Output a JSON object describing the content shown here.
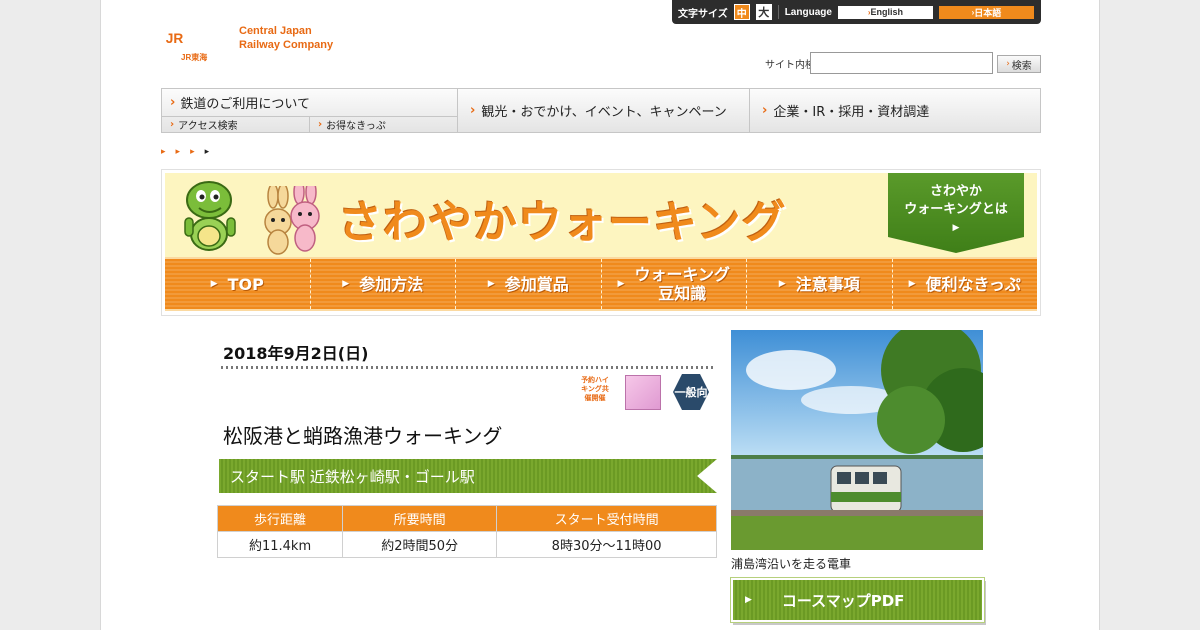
{
  "header": {
    "logo_mark": "JR",
    "logo_line1": "Central Japan",
    "logo_line2": "Railway Company",
    "logo_sub": "JR東海"
  },
  "toolbar": {
    "font_size_label": "文字サイズ",
    "font_mid": "中",
    "font_big": "大",
    "language_label": "Language",
    "lang_en": "English",
    "lang_jp": "日本語"
  },
  "search": {
    "label": "サイト内検索",
    "placeholder": "",
    "button": "検索"
  },
  "nav": {
    "main": "鉄道のご利用について",
    "sub1": "アクセス検索",
    "sub2": "お得なきっぷ",
    "tourism": "観光・おでかけ、イベント、キャンペーン",
    "corporate": "企業・IR・採用・資材調達"
  },
  "banner": {
    "title": "さわやかウォーキング",
    "about_line1": "さわやか",
    "about_line2": "ウォーキングとは",
    "about_arrow": "▶"
  },
  "gnav": [
    {
      "label": "TOP"
    },
    {
      "label": "参加方法"
    },
    {
      "label": "参加賞品"
    },
    {
      "label": "ウォーキング\n豆知識"
    },
    {
      "label": "注意事項"
    },
    {
      "label": "便利なきっぷ"
    }
  ],
  "event": {
    "date": "2018年9月2日(日)",
    "badge1": "予約ハイキング共催開催",
    "badge3": "一般向",
    "title": "松阪港と蛸路漁港ウォーキング",
    "course": "スタート駅 近鉄松ヶ崎駅・ゴール駅",
    "table_headers": [
      "歩行距離",
      "所要時間",
      "スタート受付時間"
    ],
    "table_values": [
      "約11.4km",
      "約2時間50分",
      "8時30分〜11時00"
    ]
  },
  "photo": {
    "caption": "浦島湾沿いを走る電車"
  },
  "pdf_button": "コースマップPDF",
  "colors": {
    "orange": "#f08a1c",
    "green": "#6b9a24",
    "dark": "#2d2d2d"
  }
}
